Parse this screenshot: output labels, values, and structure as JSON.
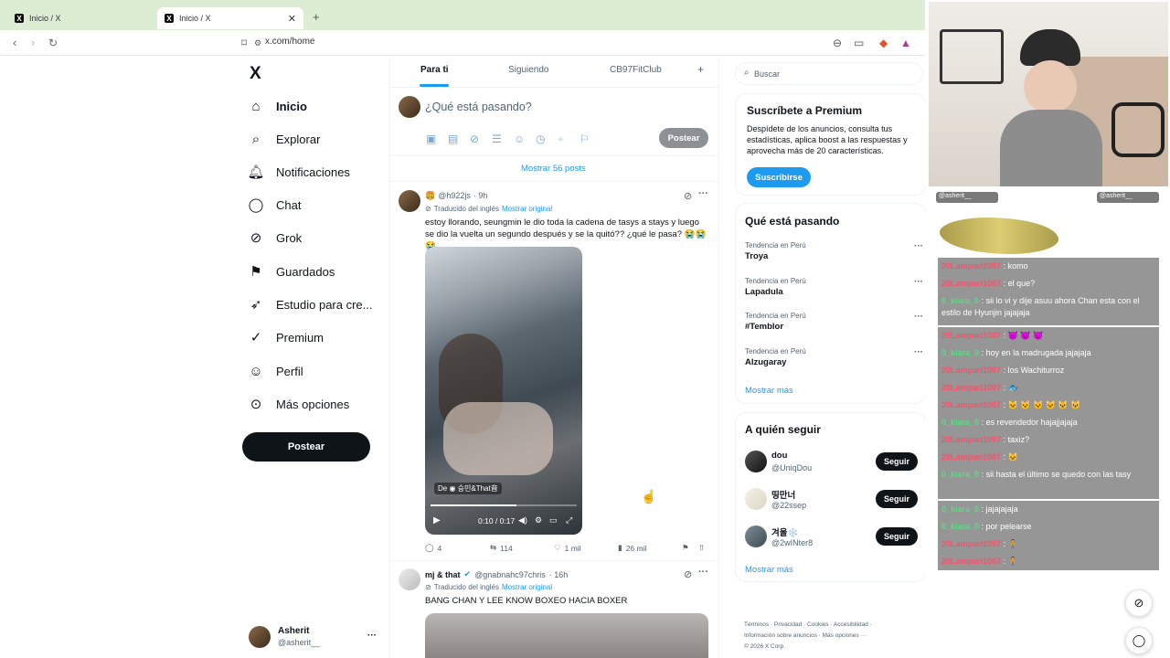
{
  "browser": {
    "tabs": [
      {
        "title": "Inicio / X"
      },
      {
        "title": "Inicio / X"
      }
    ],
    "new_tab": "+",
    "url": "x.com/home"
  },
  "nav": {
    "logo": "X",
    "items": [
      {
        "label": "Inicio",
        "icon": "home-icon",
        "active": true
      },
      {
        "label": "Explorar",
        "icon": "search-icon"
      },
      {
        "label": "Notificaciones",
        "icon": "bell-icon"
      },
      {
        "label": "Chat",
        "icon": "chat-icon"
      },
      {
        "label": "Grok",
        "icon": "grok-icon"
      },
      {
        "label": "Guardados",
        "icon": "bookmark-icon"
      },
      {
        "label": "Estudio para cre...",
        "icon": "rocket-icon"
      },
      {
        "label": "Premium",
        "icon": "verified-icon"
      },
      {
        "label": "Perfil",
        "icon": "person-icon"
      },
      {
        "label": "Más opciones",
        "icon": "more-circle-icon"
      }
    ],
    "post_button": "Postear",
    "account": {
      "name": "Asherit",
      "handle": "@asherit__",
      "more": "···"
    }
  },
  "feed": {
    "tabs": [
      "Para ti",
      "Siguiendo",
      "CB97FitClub"
    ],
    "add_tab": "+",
    "composer": {
      "placeholder": "¿Qué está pasando?",
      "post": "Postear"
    },
    "show_posts": "Mostrar 56 posts",
    "tweets": [
      {
        "handle": "@h922js",
        "time": "· 9h",
        "translated": "Traducido del inglés",
        "show_original": "Mostrar original",
        "text": "estoy llorando, seungmin le dio toda la cadena de tasys a stays y luego se dio la vuelta un segundo después y se la quitó?? ¿qué le pasa? 😭😭😭",
        "video": {
          "credit": "De ◉ 승민&That音",
          "time": "0:10 / 0:17"
        },
        "stats": {
          "replies": "4",
          "retweets": "114",
          "likes": "1 mil",
          "views": "26 mil"
        }
      },
      {
        "name": "mj & that",
        "handle": "@gnabnahc97chris",
        "time": "· 16h",
        "translated": "Traducido del inglés",
        "show_original": "Mostrar original",
        "text": "BANG CHAN Y LEE KNOW BOXEO HACIA BOXER"
      }
    ]
  },
  "sidebar": {
    "search_placeholder": "Buscar",
    "premium": {
      "title": "Suscríbete a Premium",
      "body": "Despídete de los anuncios, consulta tus estadísticas, aplica boost a las respuestas y aprovecha más de 20 características.",
      "button": "Suscribirse"
    },
    "trends": {
      "title": "Qué está pasando",
      "items": [
        {
          "meta": "Tendencia en Perú",
          "name": "Troya"
        },
        {
          "meta": "Tendencia en Perú",
          "name": "Lapadula"
        },
        {
          "meta": "Tendencia en Perú",
          "name": "#Temblor"
        },
        {
          "meta": "Tendencia en Perú",
          "name": "Alzugaray"
        }
      ],
      "more": "Mostrar más"
    },
    "follow": {
      "title": "A quién seguir",
      "items": [
        {
          "name": "dou",
          "handle": "@UniqDou",
          "button": "Seguir"
        },
        {
          "name": "띵만너",
          "handle": "@22ssep",
          "button": "Seguir"
        },
        {
          "name": "겨울❄️",
          "handle": "@2wINter8",
          "button": "Seguir"
        }
      ],
      "more": "Mostrar más"
    },
    "footer": {
      "line1": [
        "Términos",
        "Privacidad",
        "Cookies",
        "Accesibilidad"
      ],
      "line2": "Información sobre anuncios  ·  Más opciones ···",
      "copyright": "© 2026 X Corp."
    }
  },
  "stream": {
    "badge_left": "@asherit__",
    "badge_right": "@asherit__",
    "chat": [
      {
        "user": "20Lampari1007",
        "msg": ": komo",
        "u": 1
      },
      {
        "user": "20Lampari1007",
        "msg": ": el que?",
        "u": 1
      },
      {
        "user": "0_kiara_0",
        "msg": ": sii lo vi y dije asuu ahora Chan esta con el estilo de Hyunjin jajajaja",
        "u": 2
      },
      {
        "user": "20Lampari1007",
        "msg": ": 😈 😈 😈",
        "u": 1
      },
      {
        "user": "0_kiara_0",
        "msg": ": hoy en la madrugada jajajaja",
        "u": 2
      },
      {
        "user": "20Lampari1007",
        "msg": ": los Wachiturroz",
        "u": 1
      },
      {
        "user": "20Lampari1007",
        "msg": ": 🐟",
        "u": 1
      },
      {
        "user": "20Lampari1007",
        "msg": ": 🐱 🐱 🐱 🐱 🐱 🐱",
        "u": 1
      },
      {
        "user": "0_kiara_0",
        "msg": ": es revendedor hajajjajaja",
        "u": 2
      },
      {
        "user": "20Lampari1007",
        "msg": ": taxiz?",
        "u": 1
      },
      {
        "user": "20Lampari1007",
        "msg": ": 🐱",
        "u": 1
      },
      {
        "user": "0_kiara_0",
        "msg": ": sii hasta el último se quedo con las tasy",
        "u": 2
      },
      {
        "user": "0_kiara_0",
        "msg": ": jajajajaja",
        "u": 2
      },
      {
        "user": "0_kiara_0",
        "msg": ": por pelearse",
        "u": 2
      },
      {
        "user": "20Lampari1007",
        "msg": ": 🧍",
        "u": 1
      },
      {
        "user": "20Lampari1007",
        "msg": ": 🧍",
        "u": 1
      }
    ]
  }
}
